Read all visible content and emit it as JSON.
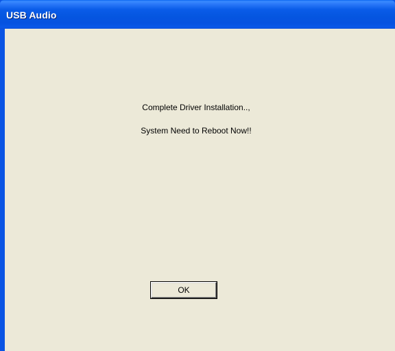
{
  "window": {
    "title": "USB Audio"
  },
  "message": {
    "line1": "Complete Driver Installation..,",
    "line2": "System Need to Reboot Now!!"
  },
  "buttons": {
    "ok_label": "OK"
  },
  "colors": {
    "titlebar": "#0a54e4",
    "client_background": "#ece9d8",
    "title_text": "#ffffff"
  }
}
